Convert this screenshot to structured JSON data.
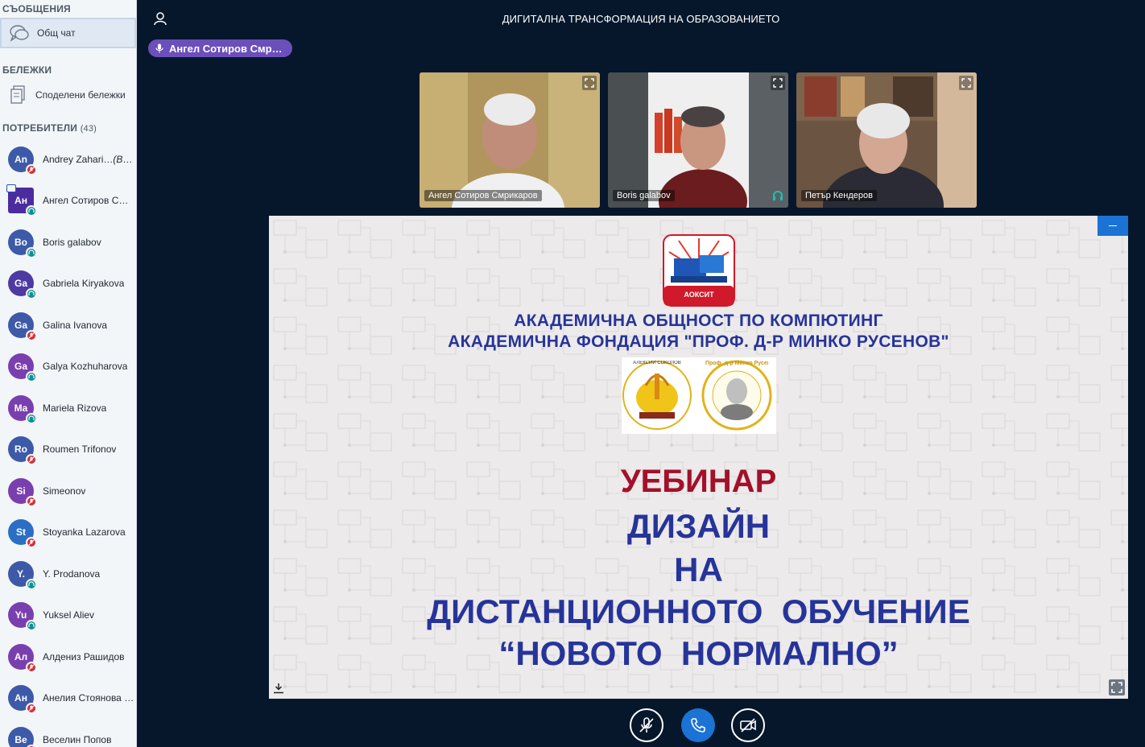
{
  "sidebar": {
    "messages_title": "СЪОБЩЕНИЯ",
    "public_chat_label": "Общ чат",
    "notes_title": "БЕЛЕЖКИ",
    "shared_notes_label": "Споделени бележки",
    "users_title": "ПОТРЕБИТЕЛИ",
    "users_count": "(43)",
    "users": [
      {
        "initials": "An",
        "name": "Andrey Zahari…",
        "suffix": "(Вие)",
        "color": "#3d5aa8",
        "status": "red"
      },
      {
        "initials": "Ан",
        "name": "Ангел Сотиров С…",
        "suffix": "",
        "color": "#4b2c9e",
        "status": "teal"
      },
      {
        "initials": "Bo",
        "name": "Boris galabov",
        "suffix": "",
        "color": "#3d5aa8",
        "status": "teal"
      },
      {
        "initials": "Ga",
        "name": "Gabriela Kiryakova",
        "suffix": "",
        "color": "#4e3aa3",
        "status": "teal"
      },
      {
        "initials": "Ga",
        "name": "Galina Ivanova",
        "suffix": "",
        "color": "#3d5aa8",
        "status": "red"
      },
      {
        "initials": "Ga",
        "name": "Galya Kozhuharova",
        "suffix": "",
        "color": "#7a3fae",
        "status": "teal"
      },
      {
        "initials": "Ma",
        "name": "Mariela Rizova",
        "suffix": "",
        "color": "#7a3fae",
        "status": "teal"
      },
      {
        "initials": "Ro",
        "name": "Roumen Trifonov",
        "suffix": "",
        "color": "#3d5aa8",
        "status": "red"
      },
      {
        "initials": "Si",
        "name": "Simeonov",
        "suffix": "",
        "color": "#7a3fae",
        "status": "red"
      },
      {
        "initials": "St",
        "name": "Stoyanka Lazarova",
        "suffix": "",
        "color": "#2b6fc4",
        "status": "red"
      },
      {
        "initials": "Y.",
        "name": "Y. Prodanova",
        "suffix": "",
        "color": "#3d5aa8",
        "status": "teal"
      },
      {
        "initials": "Yu",
        "name": "Yuksel Aliev",
        "suffix": "",
        "color": "#7a3fae",
        "status": "teal"
      },
      {
        "initials": "Ал",
        "name": "Алдениз Рашидов",
        "suffix": "",
        "color": "#7a3fae",
        "status": "red"
      },
      {
        "initials": "Ан",
        "name": "Анелия Стоянова …",
        "suffix": "",
        "color": "#3d5aa8",
        "status": "red"
      },
      {
        "initials": "Ве",
        "name": "Веселин Попов",
        "suffix": "",
        "color": "#3d5aa8",
        "status": "red"
      }
    ]
  },
  "header": {
    "title": "ДИГИТАЛНА ТРАНСФОРМАЦИЯ НА ОБРАЗОВАНИЕТО",
    "talking_indicator": "Ангел Сотиров Смр…"
  },
  "videos": [
    {
      "name": "Ангел Сотиров Смрикаров"
    },
    {
      "name": "Boris galabov"
    },
    {
      "name": "Петър Кендеров"
    }
  ],
  "slide": {
    "logo_caption": "АОКСИТ",
    "org_line1": "АКАДЕМИЧНА ОБЩНОСТ ПО КОМПЮТИНГ",
    "org_line2": "АКАДЕМИЧНА ФОНДАЦИЯ \"ПРОФ. Д-Р МИНКО РУСЕНОВ\"",
    "line_webinar": "УЕБИНАР",
    "line_design": "ДИЗАЙН",
    "line_na": "НА",
    "line_distance": "ДИСТАНЦИОННОТО  ОБУЧЕНИЕ",
    "line_normal": "“НОВОТО  НОРМАЛНО”",
    "seal_left_text": "АЛЕКСИЙ СОКОЛОВ",
    "seal_right_text": "Проф. д-р Минко Русенов"
  },
  "colors": {
    "background": "#06172b",
    "accent_blue": "#1b73d6",
    "talking_purple": "#6b4fbb",
    "slide_blue": "#26349a",
    "slide_red": "#a3102a"
  }
}
